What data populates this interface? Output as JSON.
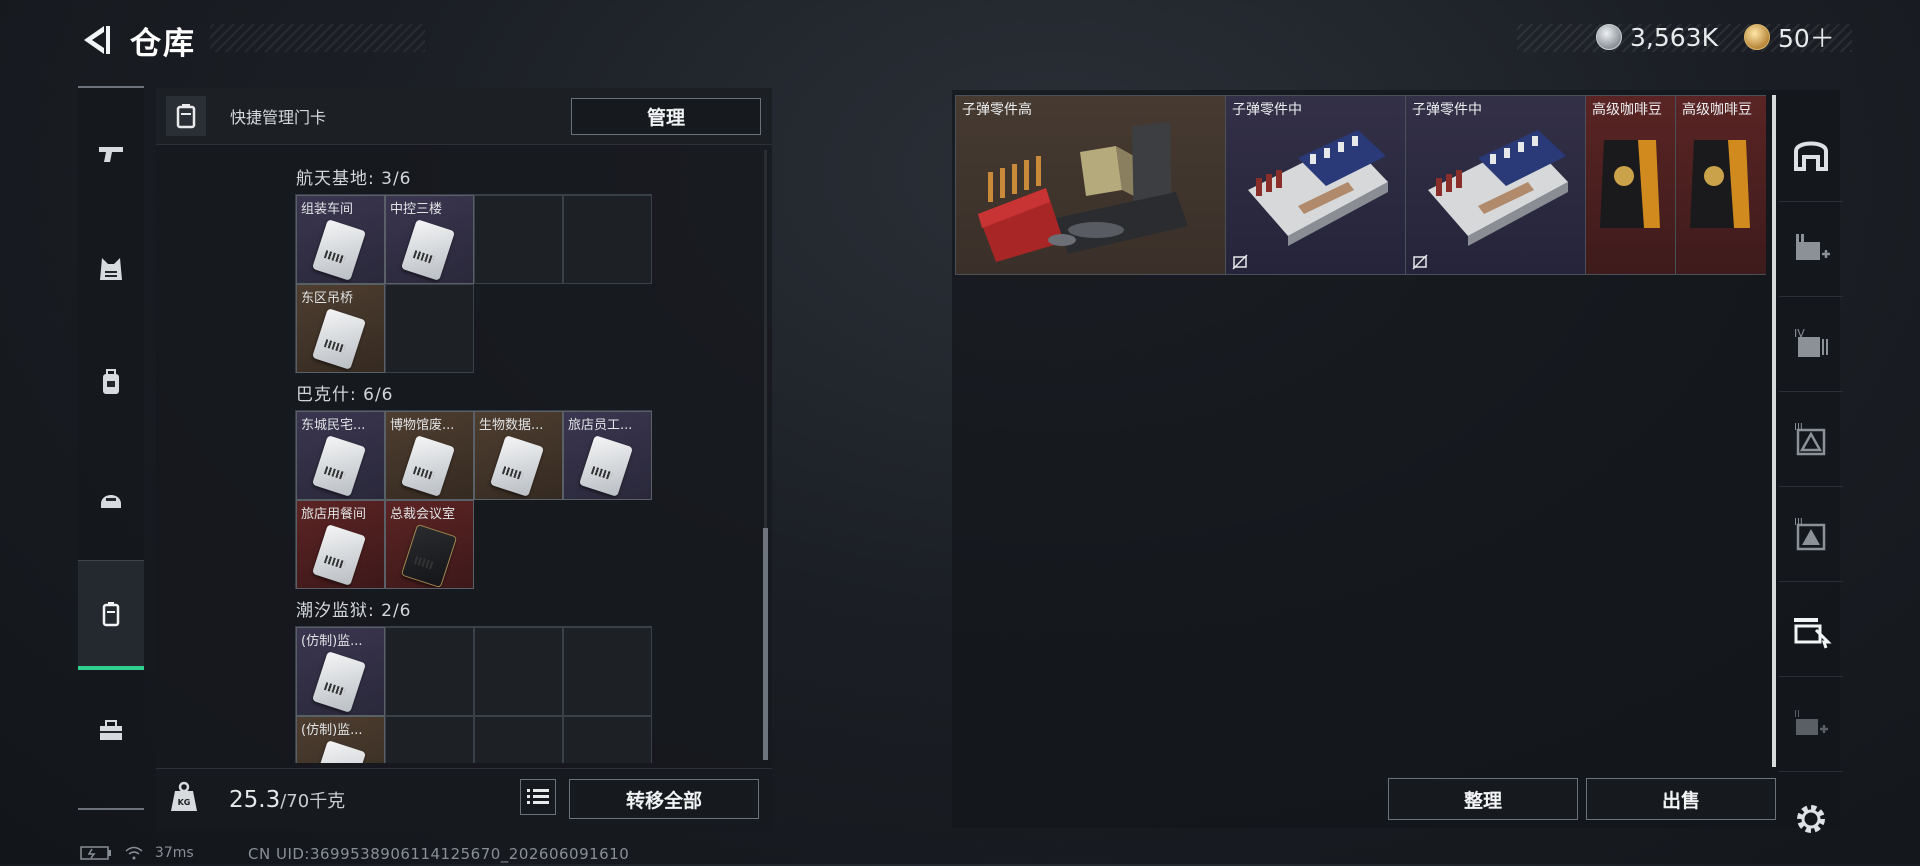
{
  "header": {
    "title": "仓库"
  },
  "currency": {
    "silver": "3,563K",
    "gold": "50＋"
  },
  "left_nav": [
    "guns",
    "armor",
    "backpack",
    "helmet",
    "keycards",
    "toolbox"
  ],
  "left_panel": {
    "top_label": "快捷管理门卡",
    "manage_button": "管理",
    "sections": [
      {
        "title": "航天基地: 3/6",
        "cards": [
          {
            "name": "组装车间",
            "rarity": "purple"
          },
          {
            "name": "中控三楼",
            "rarity": "purple"
          },
          {
            "name": "东区吊桥",
            "rarity": "tan"
          }
        ]
      },
      {
        "title": "巴克什: 6/6",
        "cards": [
          {
            "name": "东城民宅...",
            "rarity": "purple"
          },
          {
            "name": "博物馆废...",
            "rarity": "tan"
          },
          {
            "name": "生物数据...",
            "rarity": "tan"
          },
          {
            "name": "旅店员工...",
            "rarity": "purple"
          },
          {
            "name": "旅店用餐间",
            "rarity": "red"
          },
          {
            "name": "总裁会议室",
            "rarity": "red"
          }
        ]
      },
      {
        "title": "潮汐监狱: 2/6",
        "cards": [
          {
            "name": "(仿制)监...",
            "rarity": "purple"
          },
          {
            "name": "(仿制)监...",
            "rarity": "tan"
          }
        ]
      }
    ],
    "weight_current": "25.3",
    "weight_max": "/70千克",
    "transfer_all_button": "转移全部"
  },
  "stash": {
    "items": [
      {
        "name": "子弹零件高",
        "rarity": "brown",
        "no_insure": false
      },
      {
        "name": "子弹零件中",
        "rarity": "purple",
        "no_insure": true
      },
      {
        "name": "子弹零件中",
        "rarity": "purple",
        "no_insure": true
      },
      {
        "name": "高级咖啡豆",
        "rarity": "red",
        "no_insure": false
      },
      {
        "name": "高级咖啡豆",
        "rarity": "red",
        "no_insure": false
      }
    ],
    "sort_button": "整理",
    "sell_button": "出售"
  },
  "right_rail": [
    "stash-main-icon",
    "expansion-2-icon",
    "expansion-4-icon",
    "expansion-3a-icon",
    "expansion-3b-icon",
    "expansion-active-icon",
    "expansion-2b-icon",
    "settings-icon"
  ],
  "status": {
    "ping": "37ms",
    "uid": "CN UID:3699538906114125670_202606091610"
  }
}
